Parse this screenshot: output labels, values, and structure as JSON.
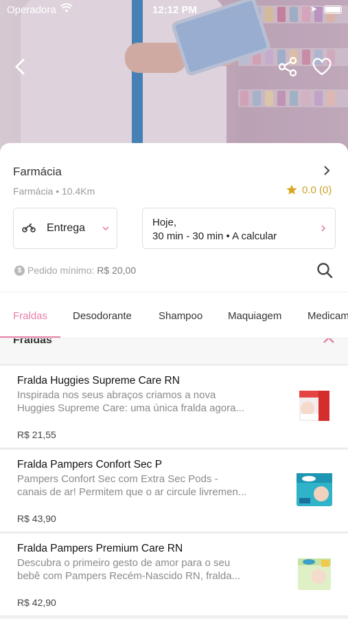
{
  "status_bar": {
    "carrier": "Operadora",
    "time": "12:12 PM"
  },
  "store": {
    "name": "Farmácia",
    "subtitle": "Farmácia • 10.4Km",
    "rating": "0.0 (0)",
    "delivery_mode": "Entrega",
    "schedule_line1": "Hoje,",
    "schedule_line2": "30 min - 30 min • A calcular",
    "min_order_label": "Pedido mínimo:",
    "min_order_value": "R$ 20,00"
  },
  "tabs": [
    "Fraldas",
    "Desodorante",
    "Shampoo",
    "Maquiagem",
    "Medicam"
  ],
  "section": {
    "title": "Fraldas"
  },
  "products": [
    {
      "name": "Fralda Huggies Supreme Care RN",
      "desc_line1": "Inspirada nos seus abraços criamos a nova",
      "desc_line2": "Huggies Supreme Care: uma única fralda agora...",
      "price": "R$ 21,55"
    },
    {
      "name": "Fralda Pampers Confort Sec P",
      "desc_line1": "Pampers Confort Sec com Extra Sec Pods -",
      "desc_line2": "canais de ar! Permitem que o ar circule livremen...",
      "price": "R$ 43,90"
    },
    {
      "name": "Fralda Pampers Premium Care RN",
      "desc_line1": "Descubra o primeiro gesto de amor para o seu",
      "desc_line2": "bebê com Pampers Recém-Nascido RN, fralda...",
      "price": "R$ 42,90"
    }
  ],
  "colors": {
    "accent": "#e87fa8",
    "star": "#d9a820"
  },
  "icons": [
    "back-arrow-icon",
    "share-icon",
    "heart-icon",
    "chevron-right-icon",
    "star-icon",
    "motorcycle-icon",
    "chevron-down-icon",
    "coin-icon",
    "search-icon",
    "caret-up-icon"
  ]
}
